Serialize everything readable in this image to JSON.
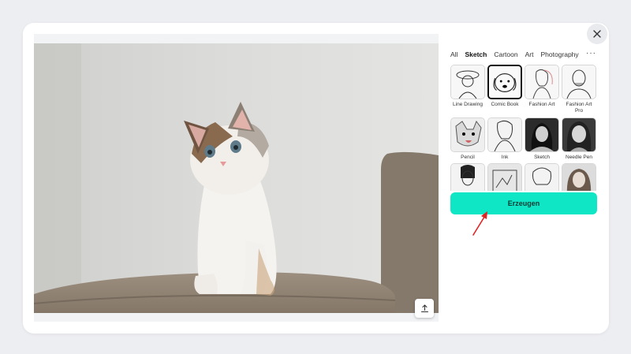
{
  "dialog": {
    "close_icon": "close-icon"
  },
  "preview": {
    "image_description_icon": "kitten-photo",
    "upload_icon": "upload-icon"
  },
  "tabs": [
    {
      "label": "All",
      "active": false
    },
    {
      "label": "Sketch",
      "active": true
    },
    {
      "label": "Cartoon",
      "active": false
    },
    {
      "label": "Art",
      "active": false
    },
    {
      "label": "Photography",
      "active": false
    }
  ],
  "more_label": "···",
  "styles": [
    {
      "label": "Line Drawing",
      "selected": false
    },
    {
      "label": "Comic Book",
      "selected": true
    },
    {
      "label": "Fashion Art",
      "selected": false
    },
    {
      "label": "Fashion Art Pro",
      "selected": false
    },
    {
      "label": "Pencil",
      "selected": false
    },
    {
      "label": "Ink",
      "selected": false
    },
    {
      "label": "Sketch",
      "selected": false
    },
    {
      "label": "Needle Pen",
      "selected": false
    },
    {
      "label": "",
      "selected": false
    },
    {
      "label": "",
      "selected": false
    },
    {
      "label": "",
      "selected": false
    },
    {
      "label": "",
      "selected": false
    }
  ],
  "generate_label": "Erzeugen",
  "colors": {
    "accent": "#0fe6c5",
    "arrow": "#e02424"
  }
}
